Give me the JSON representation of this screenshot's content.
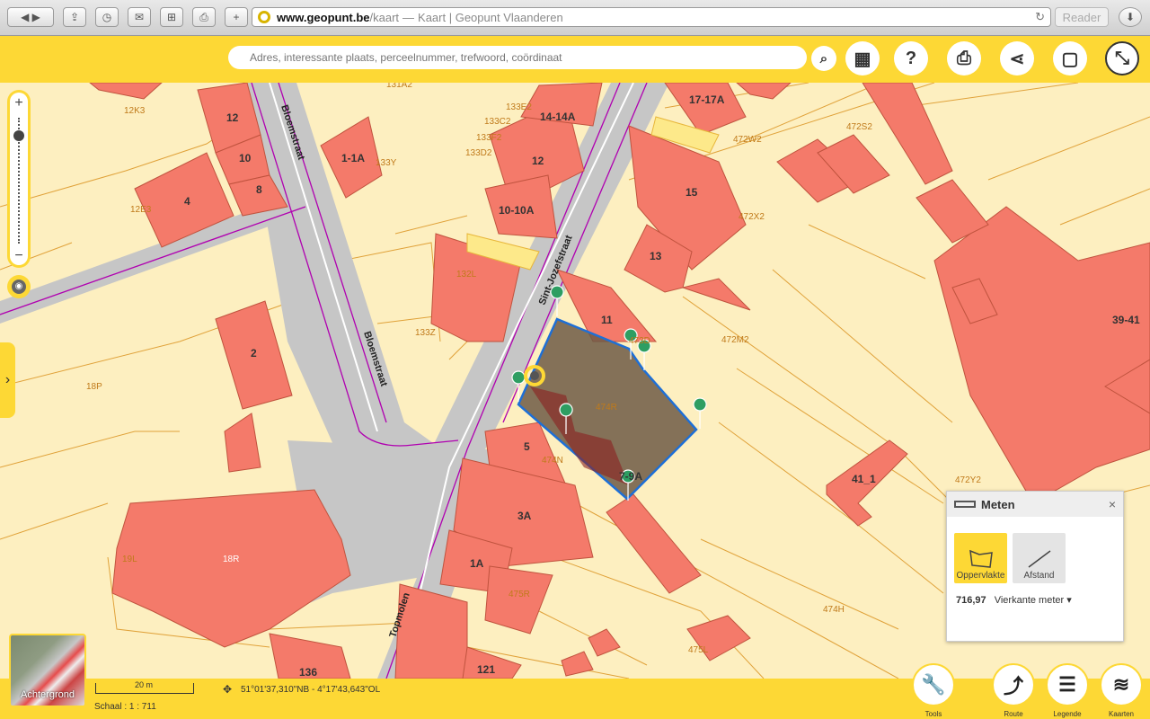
{
  "browser": {
    "url_host": "www.geopunt.be",
    "url_path": "/kaart",
    "url_sep": "—",
    "page_title": "Kaart | Geopunt Vlaanderen",
    "reader_label": "Reader"
  },
  "header": {
    "search_placeholder": "Adres, interessante plaats, perceelnummer, trefwoord, coördinaat"
  },
  "map": {
    "streets": [
      "Bloemstraat",
      "Bloemstraat",
      "Sint-Jozefstraat",
      "Topmolen"
    ],
    "labels": [
      "12",
      "10",
      "8",
      "4",
      "1-1A",
      "12",
      "10-10A",
      "14-14A",
      "17-17A",
      "15",
      "13",
      "2",
      "11",
      "5",
      "3A",
      "1A",
      "7-9A",
      "136",
      "121",
      "41_1",
      "39-41",
      "12K3",
      "12E3",
      "133Y",
      "133E2",
      "133C2",
      "133F2",
      "133D2",
      "132L",
      "133Z",
      "18P",
      "18R",
      "19L",
      "474R",
      "474N",
      "475R",
      "475L",
      "474H",
      "473D",
      "472M2",
      "472W2",
      "472X2",
      "472S2",
      "472Y2",
      "131A2",
      "12"
    ],
    "colors": {
      "parcel": "#fdefc0",
      "building": "#f47a6a",
      "road": "#c8c8c8",
      "selection": "#7a6a58",
      "outline": "#1e6fd6"
    }
  },
  "meten": {
    "title": "Meten",
    "close": "×",
    "tool_area": "Oppervlakte",
    "tool_distance": "Afstand",
    "value": "716,97",
    "unit": "Vierkante meter"
  },
  "footer": {
    "background_label": "Achtergrond",
    "scale_text": "20 m",
    "schaal": "Schaal : 1 : 711",
    "coordinates": "51°01'37,310\"NB - 4°17'43,643\"OL",
    "buttons": [
      "Tools",
      "Route",
      "Legende",
      "Kaarten"
    ]
  }
}
